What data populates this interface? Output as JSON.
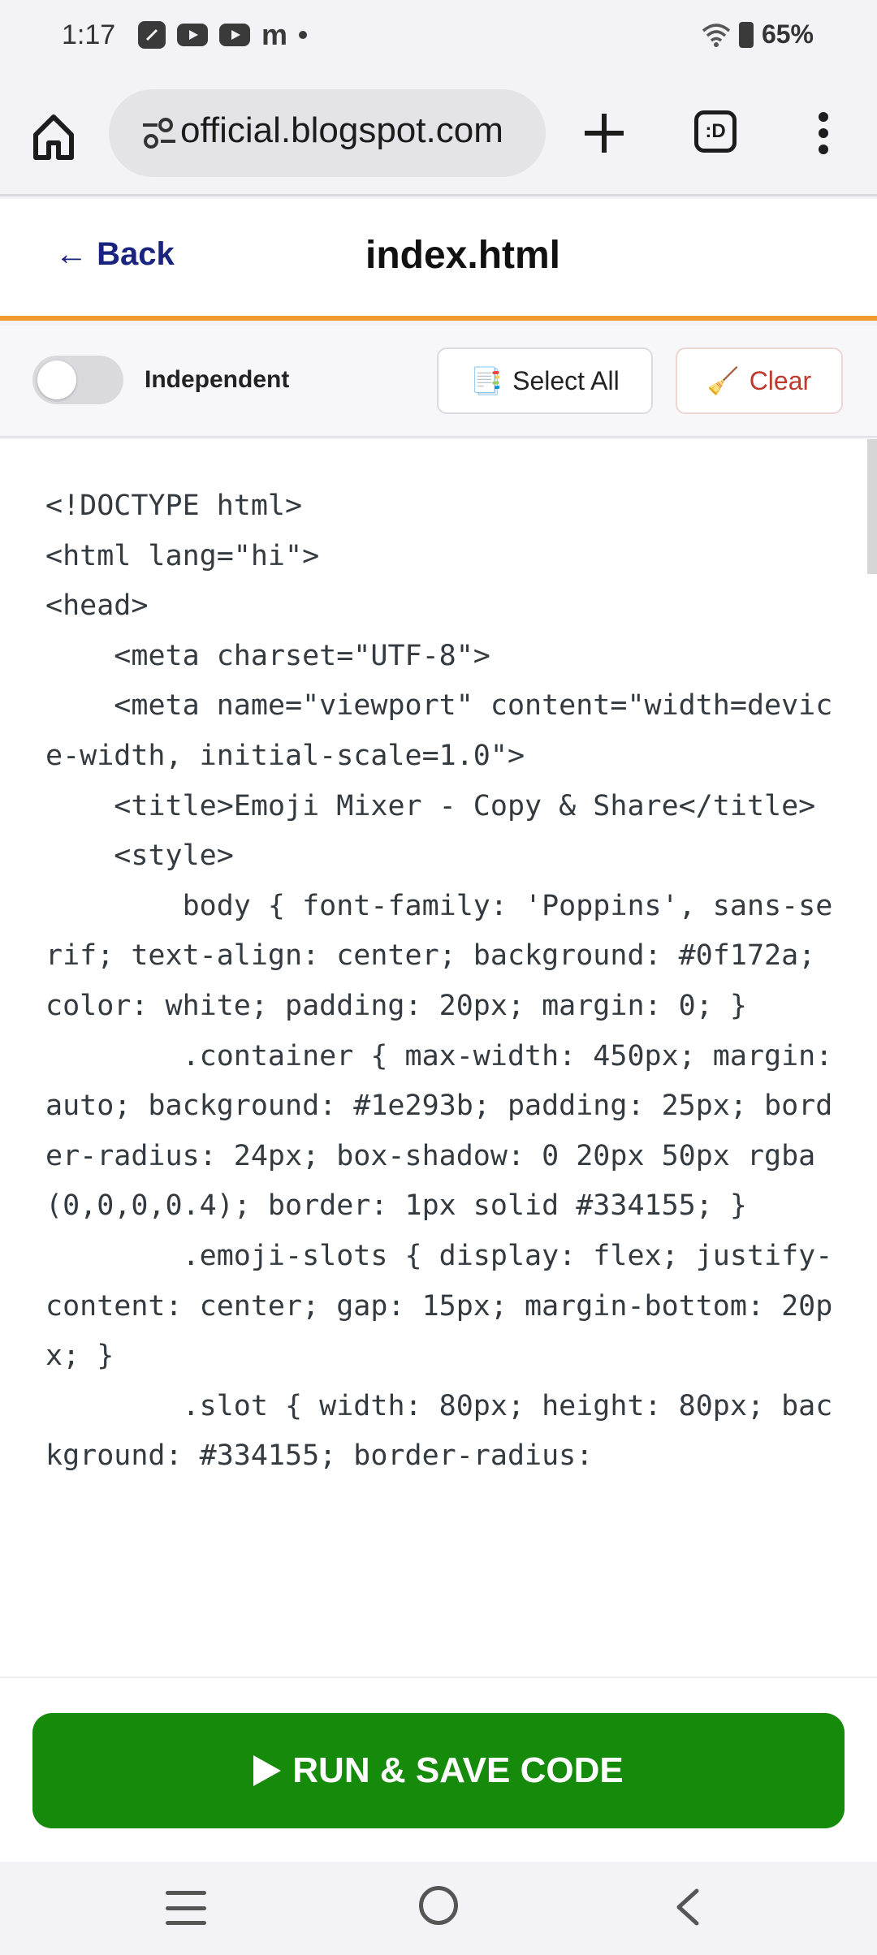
{
  "status_bar": {
    "time": "1:17",
    "battery": "65%",
    "left_icons": [
      "notes-app-icon",
      "youtube-icon",
      "youtube-icon",
      "medium-icon",
      "notification-dot"
    ],
    "right_icons": [
      "wifi-icon",
      "battery-icon"
    ]
  },
  "browser": {
    "url": "official.blogspot.com",
    "tabs_label": ":D"
  },
  "header": {
    "back_label": "← Back",
    "title": "index.html",
    "accent_color": "#f39a2d"
  },
  "toolbar": {
    "toggle_label": "Independent",
    "toggle_state": "off",
    "select_all_icon": "📑",
    "select_all_label": "Select All",
    "clear_icon": "🧹",
    "clear_label": "Clear"
  },
  "editor": {
    "code": "<!DOCTYPE html>\n<html lang=\"hi\">\n<head>\n    <meta charset=\"UTF-8\">\n    <meta name=\"viewport\" content=\"width=device-width, initial-scale=1.0\">\n    <title>Emoji Mixer - Copy & Share</title>\n    <style>\n        body { font-family: 'Poppins', sans-serif; text-align: center; background: #0f172a; color: white; padding: 20px; margin: 0; }\n        .container { max-width: 450px; margin: auto; background: #1e293b; padding: 25px; border-radius: 24px; box-shadow: 0 20px 50px rgba(0,0,0,0.4); border: 1px solid #334155; }\n        .emoji-slots { display: flex; justify-content: center; gap: 15px; margin-bottom: 20px; }\n        .slot { width: 80px; height: 80px; background: #334155; border-radius:"
  },
  "run": {
    "label": "RUN & SAVE CODE",
    "color": "#158a0b"
  }
}
